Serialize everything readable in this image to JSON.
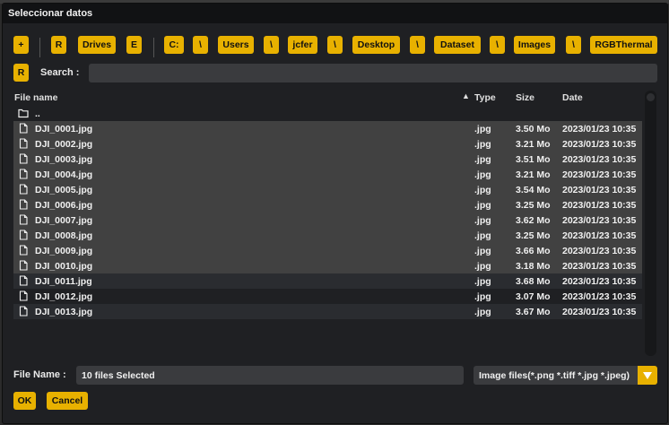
{
  "window": {
    "title": "Seleccionar datos"
  },
  "path_bar": {
    "edit_button": "+",
    "drives_refresh": "R",
    "drives_label": "Drives",
    "drive": "E",
    "segments": [
      "C:",
      "\\",
      "Users",
      "\\",
      "jcfer",
      "\\",
      "Desktop",
      "\\",
      "Dataset",
      "\\",
      "Images",
      "\\",
      "RGBThermal"
    ]
  },
  "search": {
    "refresh": "R",
    "label": "Search :",
    "value": ""
  },
  "table": {
    "headers": {
      "name": "File name",
      "type": "Type",
      "size": "Size",
      "date": "Date"
    },
    "sort_indicator": "▲",
    "parent": "..",
    "rows": [
      {
        "name": "DJI_0001.jpg",
        "type": ".jpg",
        "size": "3.50 Mo",
        "date": "2023/01/23 10:35"
      },
      {
        "name": "DJI_0002.jpg",
        "type": ".jpg",
        "size": "3.21 Mo",
        "date": "2023/01/23 10:35"
      },
      {
        "name": "DJI_0003.jpg",
        "type": ".jpg",
        "size": "3.51 Mo",
        "date": "2023/01/23 10:35"
      },
      {
        "name": "DJI_0004.jpg",
        "type": ".jpg",
        "size": "3.21 Mo",
        "date": "2023/01/23 10:35"
      },
      {
        "name": "DJI_0005.jpg",
        "type": ".jpg",
        "size": "3.54 Mo",
        "date": "2023/01/23 10:35"
      },
      {
        "name": "DJI_0006.jpg",
        "type": ".jpg",
        "size": "3.25 Mo",
        "date": "2023/01/23 10:35"
      },
      {
        "name": "DJI_0007.jpg",
        "type": ".jpg",
        "size": "3.62 Mo",
        "date": "2023/01/23 10:35"
      },
      {
        "name": "DJI_0008.jpg",
        "type": ".jpg",
        "size": "3.25 Mo",
        "date": "2023/01/23 10:35"
      },
      {
        "name": "DJI_0009.jpg",
        "type": ".jpg",
        "size": "3.66 Mo",
        "date": "2023/01/23 10:35"
      },
      {
        "name": "DJI_0010.jpg",
        "type": ".jpg",
        "size": "3.18 Mo",
        "date": "2023/01/23 10:35"
      },
      {
        "name": "DJI_0011.jpg",
        "type": ".jpg",
        "size": "3.68 Mo",
        "date": "2023/01/23 10:35"
      },
      {
        "name": "DJI_0012.jpg",
        "type": ".jpg",
        "size": "3.07 Mo",
        "date": "2023/01/23 10:35"
      },
      {
        "name": "DJI_0013.jpg",
        "type": ".jpg",
        "size": "3.67 Mo",
        "date": "2023/01/23 10:35"
      }
    ],
    "selected": [
      0,
      1,
      2,
      3,
      4,
      5,
      6,
      7,
      8,
      9
    ]
  },
  "footer": {
    "file_name_label": "File Name :",
    "file_name_value": "10 files Selected",
    "filter": "Image files(*.png *.tiff *.jpg *.jpeg)",
    "ok": "OK",
    "cancel": "Cancel"
  },
  "colors": {
    "accent": "#e8b100",
    "background": "#1f2023",
    "row_selected": "#414141",
    "row_alt": "#2a2c30"
  }
}
